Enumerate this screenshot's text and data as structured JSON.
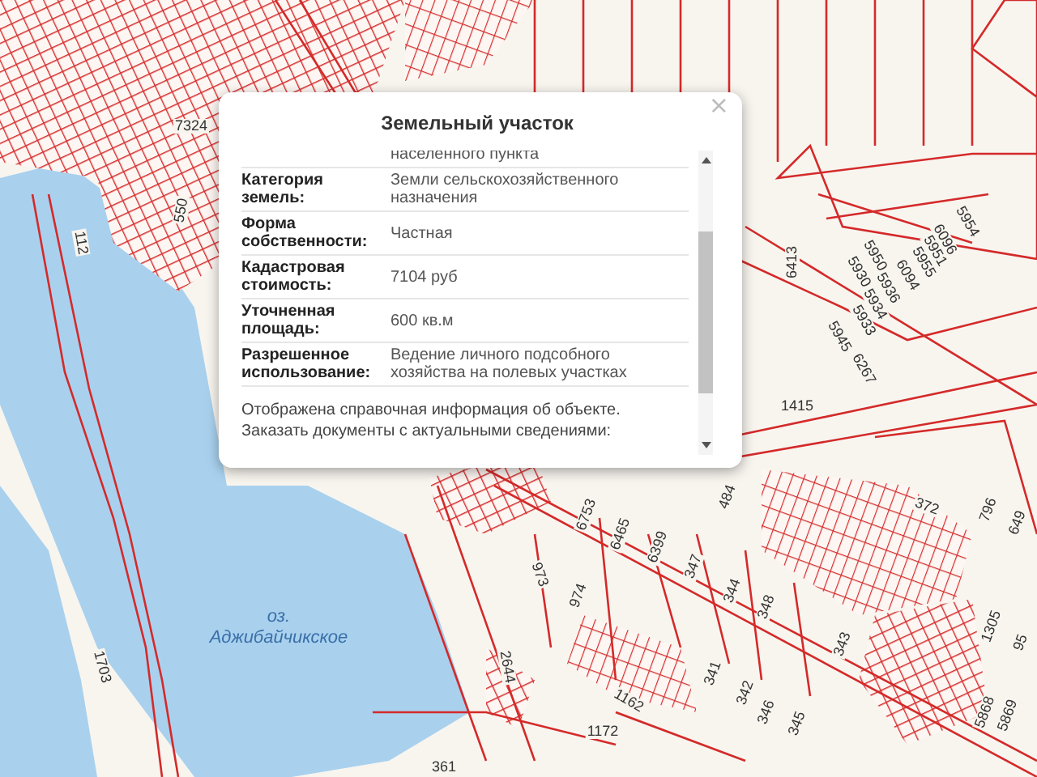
{
  "map": {
    "lake": {
      "prefix": "оз.",
      "name": "Аджибайчикское"
    },
    "parcel_labels": [
      "7324",
      "550",
      "112",
      "1415",
      "6413",
      "5954",
      "6096",
      "5951",
      "5955",
      "6094",
      "5950",
      "5930",
      "5936",
      "5934",
      "5933",
      "5945",
      "6267",
      "6753",
      "6465",
      "6399",
      "347",
      "484",
      "973",
      "974",
      "344",
      "348",
      "343",
      "341",
      "342",
      "346",
      "345",
      "1162",
      "1172",
      "372",
      "796",
      "649",
      "1305",
      "95",
      "5868",
      "5869",
      "2644",
      "361",
      "1703"
    ]
  },
  "popup": {
    "title": "Земельный участок",
    "close": "×",
    "rows": [
      {
        "label": "",
        "value": "населенного пункта"
      },
      {
        "label": "Категория земель:",
        "value": "Земли сельскохозяйственного назначения"
      },
      {
        "label": "Форма собственности:",
        "value": "Частная"
      },
      {
        "label": "Кадастровая стоимость:",
        "value": "7104 руб"
      },
      {
        "label": "Уточненная площадь:",
        "value": "600 кв.м"
      },
      {
        "label": "Разрешенное использование:",
        "value": "Ведение личного подсобного хозяйства на полевых участках"
      }
    ],
    "note": [
      "Отображена справочная информация об объекте.",
      "Заказать документы с актуальными сведениями:"
    ]
  }
}
